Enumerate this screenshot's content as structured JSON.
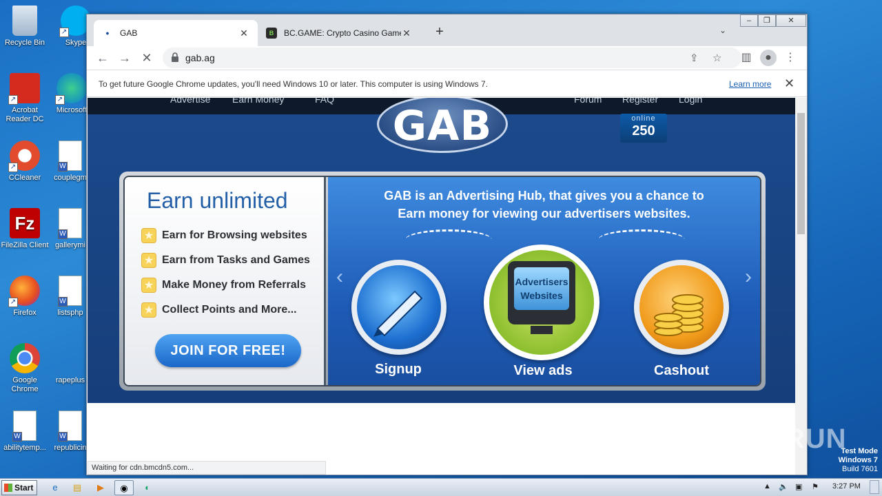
{
  "desktop": {
    "icons": [
      {
        "label": "Recycle Bin",
        "icon": "recycle-bin-icon"
      },
      {
        "label": "Skype",
        "icon": "skype-icon"
      },
      {
        "label": "Acrobat Reader DC",
        "icon": "acrobat-icon"
      },
      {
        "label": "Microsoft",
        "icon": "edge-icon"
      },
      {
        "label": "CCleaner",
        "icon": "ccleaner-icon"
      },
      {
        "label": "couplegm",
        "icon": "word-doc-icon"
      },
      {
        "label": "FileZilla Client",
        "icon": "filezilla-icon"
      },
      {
        "label": "gallerymi",
        "icon": "word-doc-icon"
      },
      {
        "label": "Firefox",
        "icon": "firefox-icon"
      },
      {
        "label": "listsphp",
        "icon": "word-doc-icon"
      },
      {
        "label": "Google Chrome",
        "icon": "chrome-icon"
      },
      {
        "label": "rapeplus",
        "icon": "blank-file-icon"
      },
      {
        "label": "abilitytemp...",
        "icon": "word-doc-icon"
      },
      {
        "label": "republicin",
        "icon": "word-doc-icon"
      }
    ]
  },
  "browser": {
    "tabs": [
      {
        "title": "GAB",
        "active": true
      },
      {
        "title": "BC.GAME: Crypto Casino Games & C",
        "active": false
      }
    ],
    "url": "gab.ag",
    "infobar": {
      "message": "To get future Google Chrome updates, you'll need Windows 10 or later. This computer is using Windows 7.",
      "link": "Learn more"
    },
    "status": "Waiting for cdn.bmcdn5.com..."
  },
  "site": {
    "nav_left": [
      "Advertise",
      "Earn Money",
      "FAQ"
    ],
    "nav_right": [
      "Forum",
      "Register",
      "Login"
    ],
    "logo_text": "GAB",
    "online_label": "online",
    "online_count": "250",
    "left_heading": "Earn unlimited",
    "features": [
      "Earn for Browsing websites",
      "Earn from Tasks and Games",
      "Make Money from Referrals",
      "Collect Points and More..."
    ],
    "join_button": "JOIN FOR FREE!",
    "headline_line1": "GAB is an Advertising Hub, that gives you a chance to",
    "headline_line2": "Earn money for viewing our advertisers websites.",
    "steps": [
      "Signup",
      "View ads",
      "Cashout"
    ],
    "monitor_text_1": "Advertisers",
    "monitor_text_2": "Websites"
  },
  "taskbar": {
    "start_label": "Start",
    "clock": "3:27 PM"
  },
  "watermark": {
    "brand": "ANY RUN",
    "line1": "Test Mode",
    "line2": "Windows 7",
    "line3": "Build 7601"
  }
}
